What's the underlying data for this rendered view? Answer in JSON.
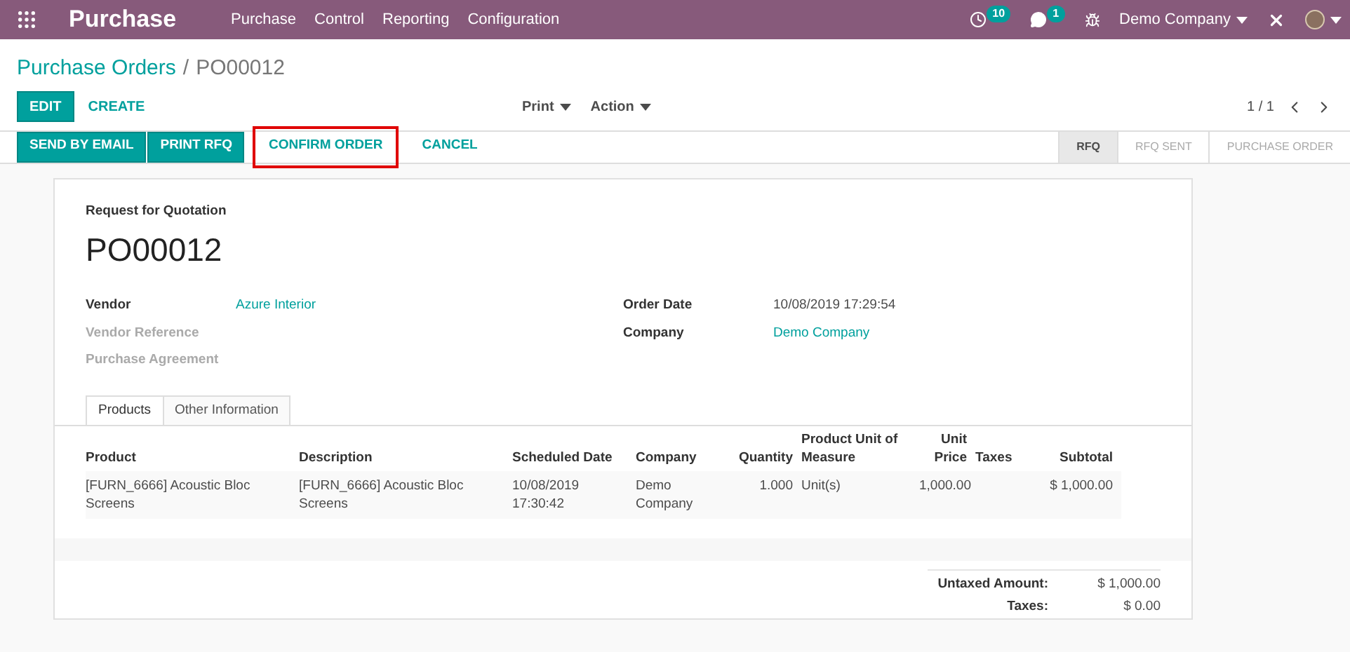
{
  "navbar": {
    "app_title": "Purchase",
    "menu": [
      "Purchase",
      "Control",
      "Reporting",
      "Configuration"
    ],
    "activity_count": "10",
    "message_count": "1",
    "company": "Demo Company"
  },
  "breadcrumb": {
    "parent": "Purchase Orders",
    "separator": "/",
    "current": "PO00012"
  },
  "control_panel": {
    "buttons": [
      {
        "label": "EDIT",
        "kind": "primary"
      },
      {
        "label": "CREATE",
        "kind": "link"
      }
    ],
    "menus": [
      "Print",
      "Action"
    ],
    "pager": "1 / 1"
  },
  "header_buttons": [
    {
      "label": "SEND BY EMAIL",
      "kind": "primary",
      "highlighted": false
    },
    {
      "label": "PRINT RFQ",
      "kind": "primary",
      "highlighted": false
    },
    {
      "label": "CONFIRM ORDER",
      "kind": "link",
      "highlighted": true
    },
    {
      "label": "CANCEL",
      "kind": "link",
      "highlighted": false
    }
  ],
  "status_steps": [
    {
      "label": "RFQ",
      "selected": true
    },
    {
      "label": "RFQ SENT",
      "selected": false
    },
    {
      "label": "PURCHASE ORDER",
      "selected": false
    }
  ],
  "sheet": {
    "subtitle": "Request for Quotation",
    "name": "PO00012",
    "left_fields": [
      {
        "label": "Vendor",
        "value": "Azure Interior",
        "filled": true
      },
      {
        "label": "Vendor Reference",
        "filled": false
      },
      {
        "label": "Purchase Agreement",
        "filled": false
      }
    ],
    "right_fields": [
      {
        "label": "Order Date",
        "value": "10/08/2019 17:29:54",
        "kind": "text"
      },
      {
        "label": "Company",
        "value": "Demo Company",
        "kind": "link"
      }
    ],
    "tabs": [
      {
        "label": "Products",
        "selected": true
      },
      {
        "label": "Other Information",
        "selected": false
      }
    ],
    "table": {
      "columns": [
        "Product",
        "Description",
        "Scheduled Date",
        "Company",
        "Quantity",
        "Product Unit of Measure",
        "Unit Price",
        "Taxes",
        "Subtotal"
      ],
      "rows": [
        [
          "[FURN_6666] Acoustic Bloc Screens",
          "[FURN_6666] Acoustic Bloc Screens",
          "10/08/2019 17:30:42",
          "Demo Company",
          "1.000",
          "Unit(s)",
          "1,000.00",
          "",
          "$ 1,000.00"
        ]
      ]
    },
    "totals": [
      {
        "label": "Untaxed Amount:",
        "value": "$ 1,000.00"
      },
      {
        "label": "Taxes:",
        "value": "$ 0.00"
      }
    ]
  }
}
